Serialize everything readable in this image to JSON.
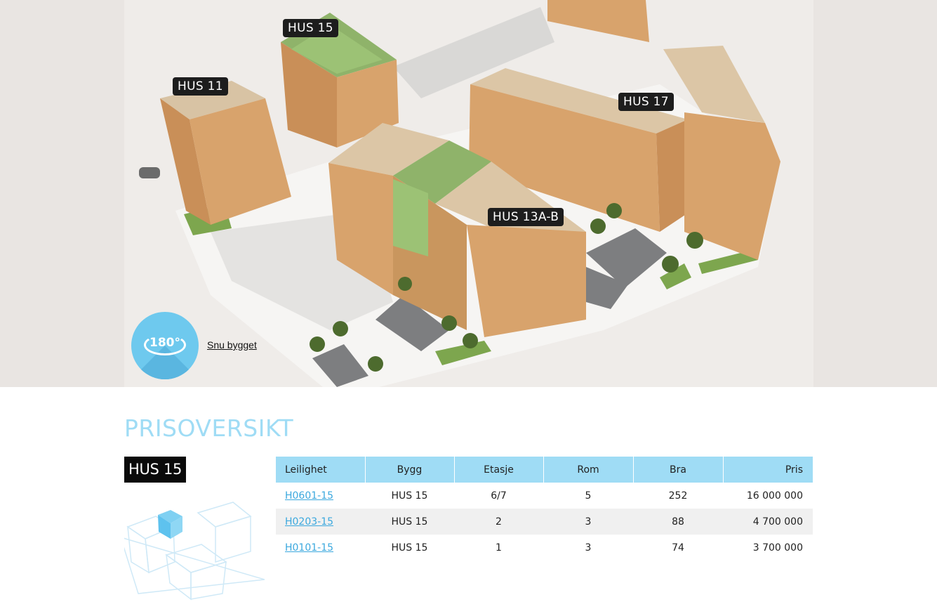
{
  "site_plan": {
    "labels": [
      "HUS 15",
      "HUS 11",
      "HUS 17",
      "HUS 13A-B"
    ],
    "rotate_badge": "180°",
    "rotate_link": "Snu bygget"
  },
  "price_overview": {
    "title": "PRISOVERSIKT",
    "selected_house": "HUS 15",
    "columns": [
      "Leilighet",
      "Bygg",
      "Etasje",
      "Rom",
      "Bra",
      "Pris"
    ],
    "rows": [
      {
        "unit": "H0601-15",
        "building": "HUS 15",
        "floor": "6/7",
        "rooms": "5",
        "area": "252",
        "price": "16 000 000"
      },
      {
        "unit": "H0203-15",
        "building": "HUS 15",
        "floor": "2",
        "rooms": "3",
        "area": "88",
        "price": "4 700 000"
      },
      {
        "unit": "H0101-15",
        "building": "HUS 15",
        "floor": "1",
        "rooms": "3",
        "area": "74",
        "price": "3 700 000"
      }
    ]
  },
  "colors": {
    "accent": "#9fdcf5",
    "link": "#3ba8de",
    "label_bg": "#1d1d1d",
    "badge": "#6ec9ee"
  }
}
